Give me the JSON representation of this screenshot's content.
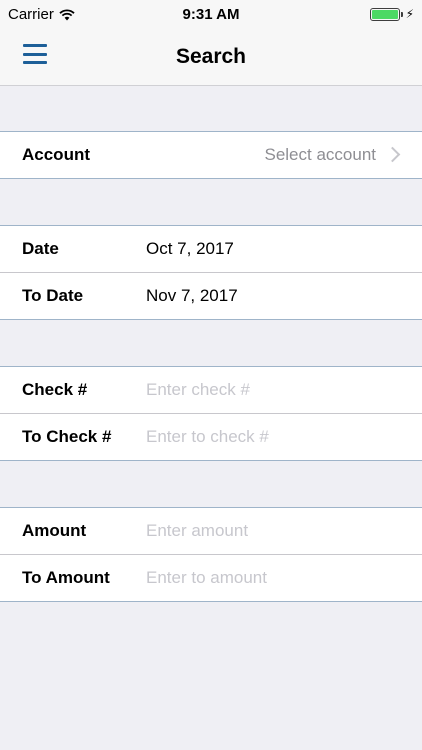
{
  "status_bar": {
    "carrier": "Carrier",
    "time": "9:31 AM"
  },
  "nav": {
    "title": "Search",
    "menu_icon": "hamburger-menu-icon",
    "accent_color": "#1d5f98"
  },
  "account": {
    "label": "Account",
    "value": "Select account"
  },
  "dates": {
    "date_label": "Date",
    "date_value": "Oct 7, 2017",
    "to_date_label": "To Date",
    "to_date_value": "Nov 7, 2017"
  },
  "checks": {
    "check_label": "Check #",
    "check_placeholder": "Enter check #",
    "to_check_label": "To Check #",
    "to_check_placeholder": "Enter to check #"
  },
  "amounts": {
    "amount_label": "Amount",
    "amount_placeholder": "Enter amount",
    "to_amount_label": "To Amount",
    "to_amount_placeholder": "Enter to amount"
  }
}
